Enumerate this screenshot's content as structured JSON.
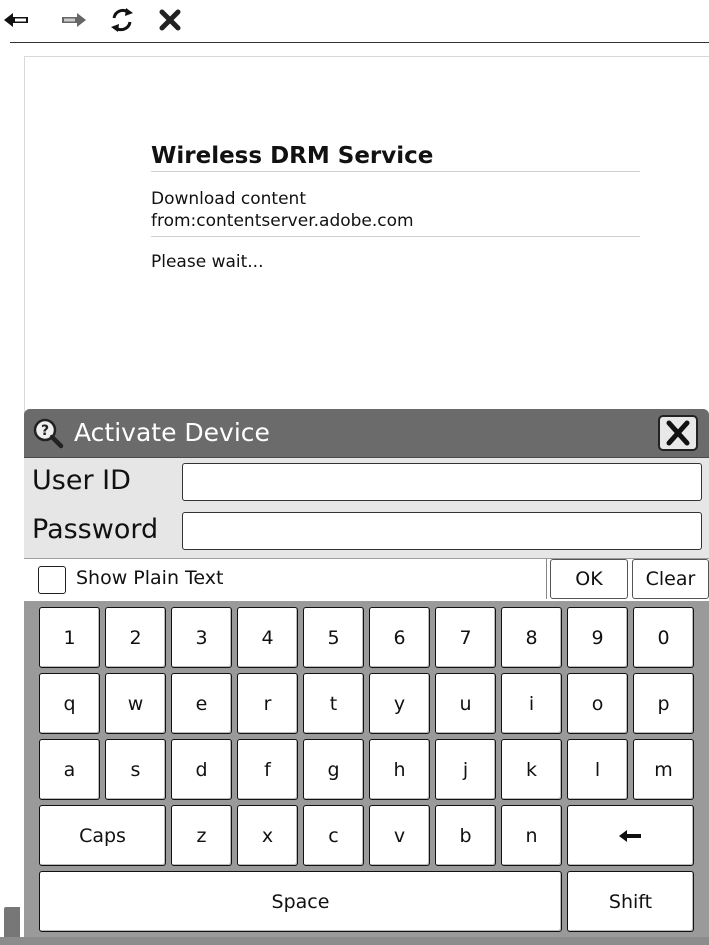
{
  "toolbar": {
    "icons": [
      "back-arrow-icon",
      "forward-arrow-icon",
      "reload-icon",
      "stop-icon"
    ]
  },
  "page": {
    "title": "Wireless DRM Service",
    "download_line1": "Download content",
    "download_line2": "from:contentserver.adobe.com",
    "wait": "Please wait..."
  },
  "dialog": {
    "title": "Activate Device",
    "title_icon": "magnifier-question-icon",
    "close_icon": "close-x-icon",
    "user_id_label": "User ID",
    "user_id_value": "",
    "password_label": "Password",
    "password_value": "",
    "show_plain_label": "Show Plain Text",
    "show_plain_checked": false,
    "ok_label": "OK",
    "clear_label": "Clear"
  },
  "keyboard": {
    "row1": [
      "1",
      "2",
      "3",
      "4",
      "5",
      "6",
      "7",
      "8",
      "9",
      "0"
    ],
    "row2": [
      "q",
      "w",
      "e",
      "r",
      "t",
      "y",
      "u",
      "i",
      "o",
      "p"
    ],
    "row3": [
      "a",
      "s",
      "d",
      "f",
      "g",
      "h",
      "j",
      "k",
      "l",
      "m"
    ],
    "caps_label": "Caps",
    "row4": [
      "z",
      "x",
      "c",
      "v",
      "b",
      "n"
    ],
    "backspace_icon": "backspace-arrow-icon",
    "space_label": "Space",
    "shift_label": "Shift"
  },
  "colors": {
    "dialog_title_bg": "#6b6b6b",
    "dialog_body_bg": "#9a9a9a",
    "form_bg": "#e6e6e6"
  }
}
